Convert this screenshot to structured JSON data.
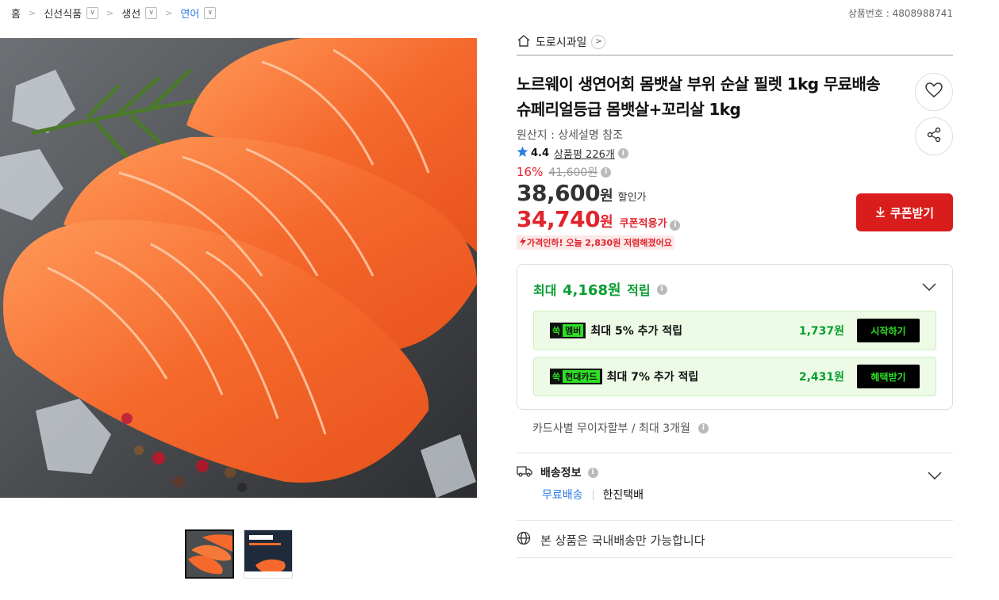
{
  "breadcrumb": {
    "home": "홈",
    "items": [
      "신선식품",
      "생선",
      "연어"
    ]
  },
  "product_no": "상품번호 : 4808988741",
  "store": {
    "name": "도로시과일"
  },
  "title": "노르웨이 생연어회 몸뱃살 부위 순살 필렛 1kg 무료배송 슈페리얼등급 몸뱃살+꼬리살 1kg",
  "origin": "원산지 : 상세설명 참조",
  "rating": {
    "score": "4.4",
    "reviews": "상품평 226개"
  },
  "discount": {
    "rate": "16%",
    "original": "41,600원"
  },
  "price": {
    "amount": "38,600",
    "unit": "원",
    "label": "할인가"
  },
  "coupon_price": {
    "amount": "34,740",
    "unit": "원",
    "label": "쿠폰적용가"
  },
  "price_drop": "가격인하! 오늘 2,830원 저렴해졌어요",
  "coupon_button": "쿠폰받기",
  "reward": {
    "head_prefix": "최대",
    "head_amount": "4,168원",
    "head_suffix": "적립",
    "rows": [
      {
        "tag": "쏙",
        "tag_label": "멤버",
        "text": "최대 5% 추가 적립",
        "value": "1,737원",
        "action": "시작하기"
      },
      {
        "tag": "쏙",
        "tag_label": "현대카드",
        "text": "최대 7% 추가 적립",
        "value": "2,431원",
        "action": "혜택받기"
      }
    ]
  },
  "installment": "카드사별 무이자할부 / 최대 3개월",
  "shipping": {
    "title": "배송정보",
    "free": "무료배송",
    "carrier": "한진택배"
  },
  "domestic_only": "본 상품은 국내배송만 가능합니다",
  "colors": {
    "accent_red": "#e0242d",
    "coupon_btn": "#d91c1c",
    "green": "#0a9e32",
    "link_blue": "#2d7be5"
  },
  "icons": [
    "home-icon",
    "heart-icon",
    "share-icon",
    "star-icon",
    "download-icon",
    "chevron-down-icon",
    "truck-icon",
    "globe-icon",
    "info-icon"
  ]
}
